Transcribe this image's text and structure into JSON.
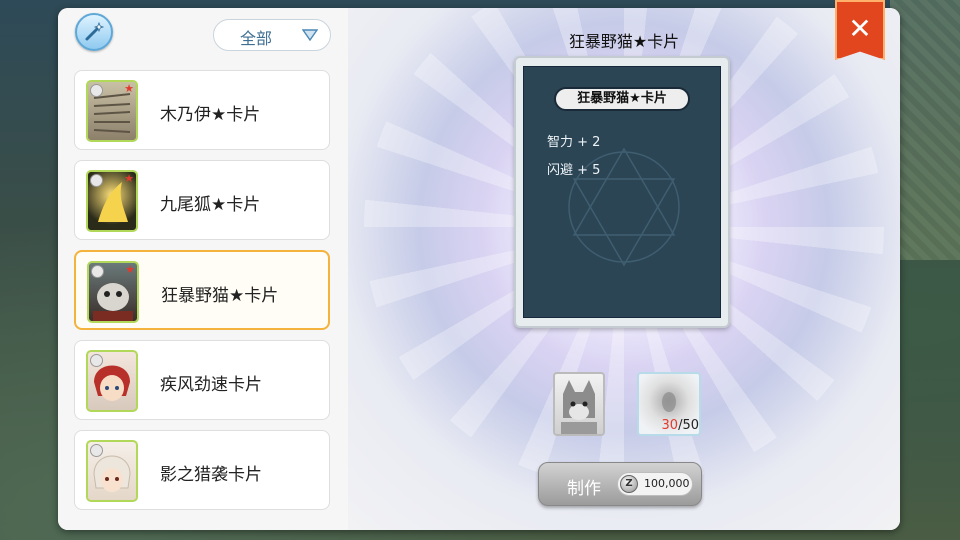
{
  "filter": {
    "label": "全部"
  },
  "card_list": [
    {
      "name": "木乃伊★卡片",
      "portrait": "mummy-portrait",
      "star": "★",
      "selected": false
    },
    {
      "name": "九尾狐★卡片",
      "portrait": "nine-tail-fox-portrait",
      "star": "★",
      "selected": false
    },
    {
      "name": "狂暴野猫★卡片",
      "portrait": "wild-cat-portrait",
      "star": "★",
      "selected": true
    },
    {
      "name": "疾风劲速卡片",
      "portrait": "red-hair-portrait",
      "star": "",
      "selected": false
    },
    {
      "name": "影之猎袭卡片",
      "portrait": "white-hair-portrait",
      "star": "",
      "selected": false
    }
  ],
  "detail": {
    "title": "狂暴野猫★卡片",
    "card_name": "狂暴野猫★卡片",
    "stats": [
      "智力 + 2",
      "闪避 + 5"
    ]
  },
  "materials": {
    "have": "30",
    "separator": "/",
    "need": "50"
  },
  "craft": {
    "label": "制作",
    "cost": "100,000",
    "currency_icon": "zeny-coin-icon"
  },
  "close": {
    "glyph": "✕"
  },
  "colors": {
    "accent": "#f3b33c",
    "close": "#e2461f",
    "card_bg": "#2b4555",
    "count_red": "#e23a2e"
  }
}
